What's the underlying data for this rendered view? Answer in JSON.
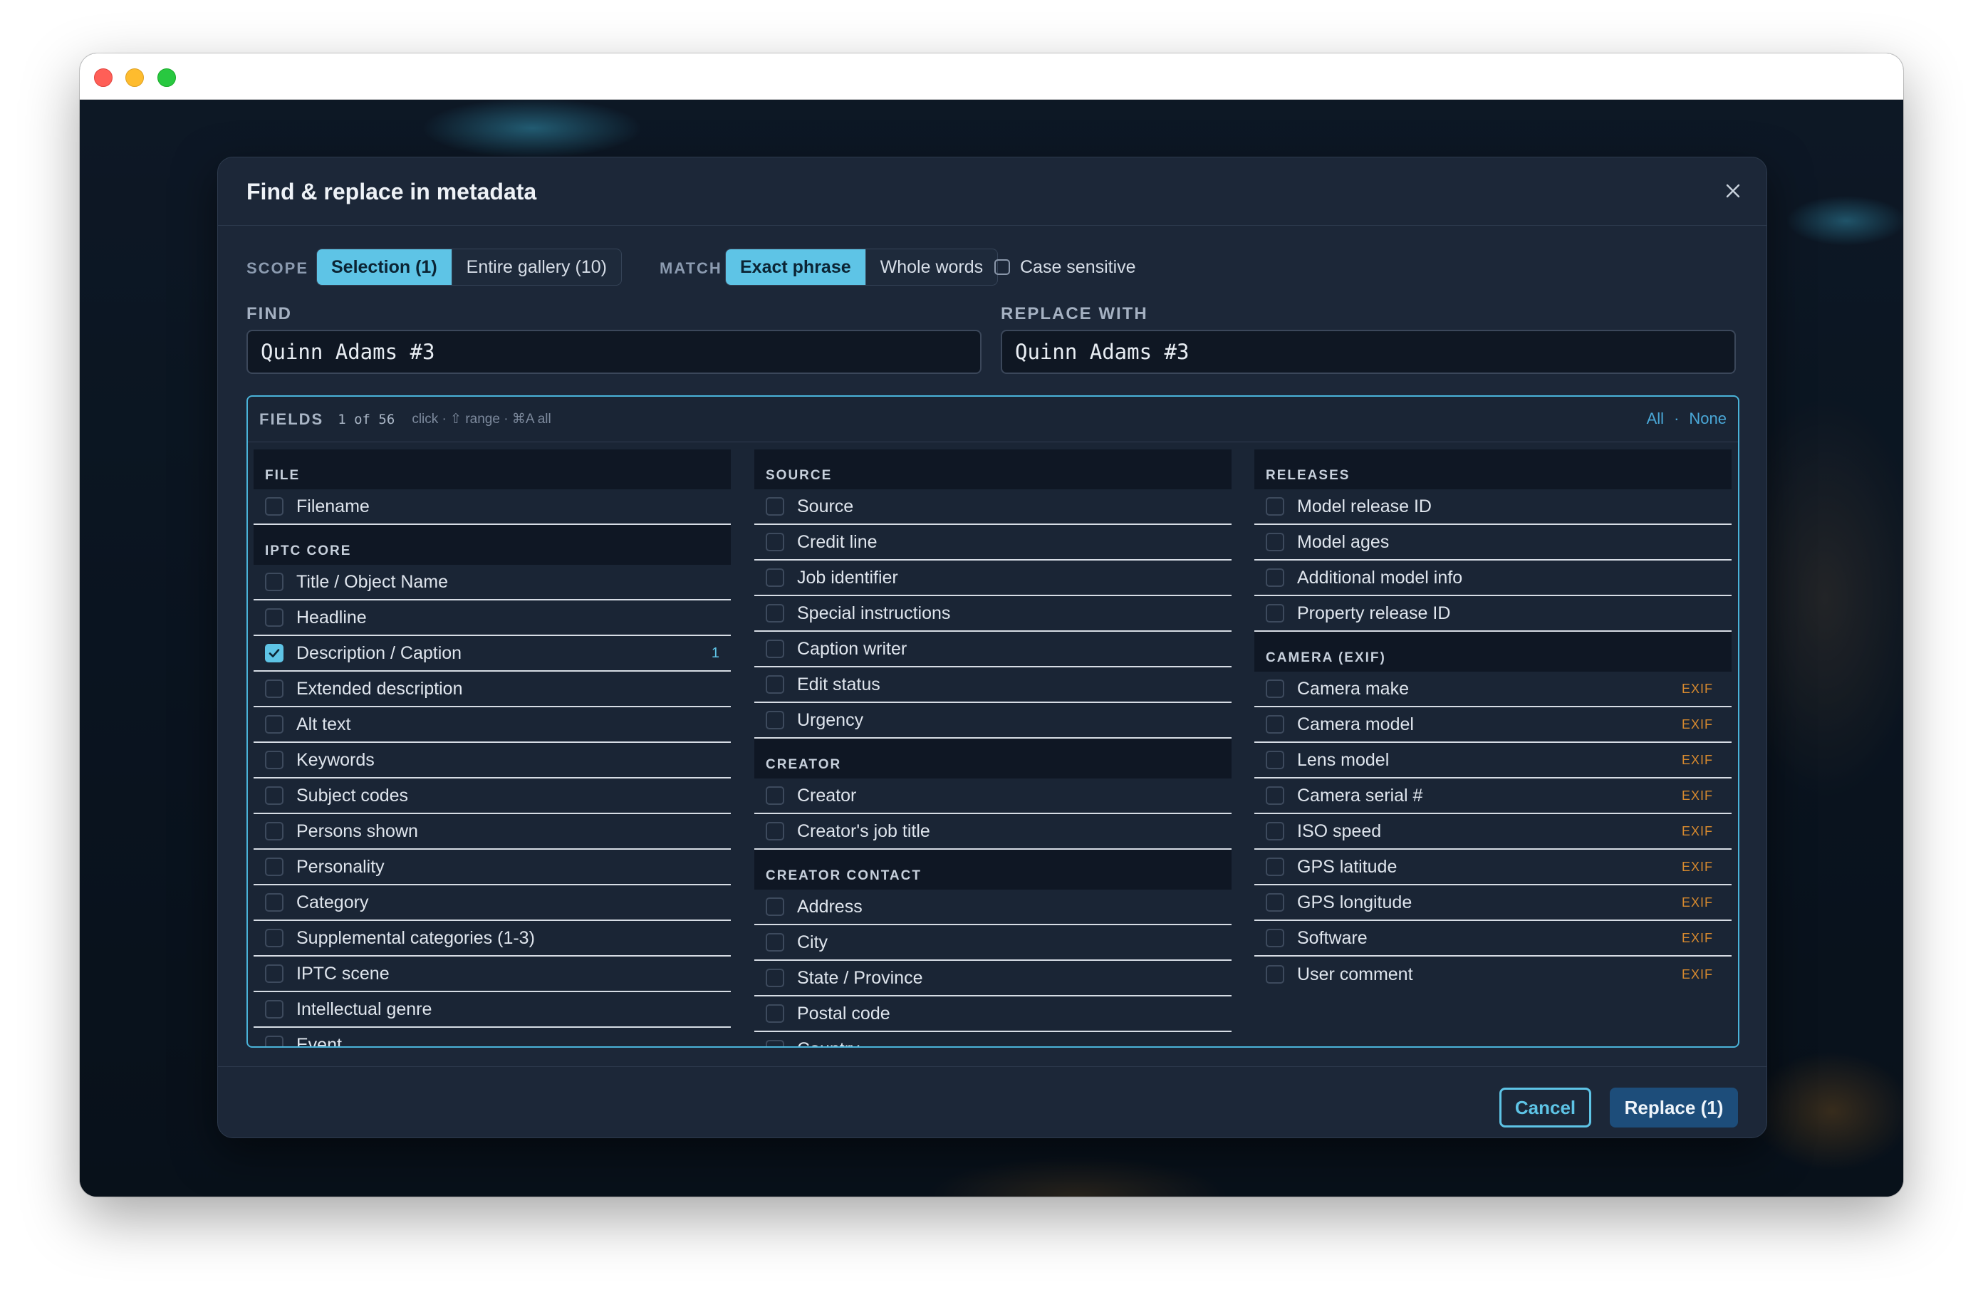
{
  "dialog": {
    "title": "Find & replace in metadata",
    "close_icon": "close-icon"
  },
  "toolbar": {
    "scope_label": "SCOPE",
    "scope_options": [
      "Selection (1)",
      "Entire gallery (10)"
    ],
    "scope_selected": "Selection (1)",
    "match_label": "MATCH",
    "match_options": [
      "Exact phrase",
      "Whole words"
    ],
    "match_selected": "Exact phrase",
    "case_label": "Case sensitive",
    "case_checked": false
  },
  "find": {
    "label": "FIND",
    "value": "Quinn Adams #3"
  },
  "replace": {
    "label": "REPLACE WITH",
    "value": "Quinn Adams #3"
  },
  "fields": {
    "title": "FIELDS",
    "count": "1 of 56",
    "hint": "click · ⇧ range · ⌘A all",
    "all_label": "All",
    "separator": "·",
    "none_label": "None",
    "columns": [
      [
        {
          "group": "FILE",
          "items": [
            {
              "label": "Filename"
            }
          ]
        },
        {
          "group": "IPTC CORE",
          "items": [
            {
              "label": "Title / Object Name"
            },
            {
              "label": "Headline"
            },
            {
              "label": "Description / Caption",
              "checked": true,
              "count": "1"
            },
            {
              "label": "Extended description"
            },
            {
              "label": "Alt text"
            },
            {
              "label": "Keywords"
            },
            {
              "label": "Subject codes"
            },
            {
              "label": "Persons shown"
            },
            {
              "label": "Personality"
            },
            {
              "label": "Category"
            },
            {
              "label": "Supplemental categories (1-3)"
            },
            {
              "label": "IPTC scene"
            },
            {
              "label": "Intellectual genre"
            },
            {
              "label": "Event"
            }
          ]
        }
      ],
      [
        {
          "group": "SOURCE",
          "items": [
            {
              "label": "Source"
            },
            {
              "label": "Credit line"
            },
            {
              "label": "Job identifier"
            },
            {
              "label": "Special instructions"
            },
            {
              "label": "Caption writer"
            },
            {
              "label": "Edit status"
            },
            {
              "label": "Urgency"
            }
          ]
        },
        {
          "group": "CREATOR",
          "items": [
            {
              "label": "Creator"
            },
            {
              "label": "Creator's job title"
            }
          ]
        },
        {
          "group": "CREATOR CONTACT",
          "items": [
            {
              "label": "Address"
            },
            {
              "label": "City"
            },
            {
              "label": "State / Province"
            },
            {
              "label": "Postal code"
            },
            {
              "label": "Country"
            }
          ]
        }
      ],
      [
        {
          "group": "RELEASES",
          "items": [
            {
              "label": "Model release ID"
            },
            {
              "label": "Model ages"
            },
            {
              "label": "Additional model info"
            },
            {
              "label": "Property release ID"
            }
          ]
        },
        {
          "group": "CAMERA (EXIF)",
          "items": [
            {
              "label": "Camera make",
              "tag": "EXIF"
            },
            {
              "label": "Camera model",
              "tag": "EXIF"
            },
            {
              "label": "Lens model",
              "tag": "EXIF"
            },
            {
              "label": "Camera serial #",
              "tag": "EXIF"
            },
            {
              "label": "ISO speed",
              "tag": "EXIF"
            },
            {
              "label": "GPS latitude",
              "tag": "EXIF"
            },
            {
              "label": "GPS longitude",
              "tag": "EXIF"
            },
            {
              "label": "Software",
              "tag": "EXIF"
            },
            {
              "label": "User comment",
              "tag": "EXIF",
              "last": true
            }
          ]
        }
      ]
    ]
  },
  "footer": {
    "cancel_label": "Cancel",
    "replace_label": "Replace (1)"
  },
  "colors": {
    "accent": "#5ec4e6",
    "primary": "#1d4d7a",
    "exif_tag": "#d88a2e"
  }
}
